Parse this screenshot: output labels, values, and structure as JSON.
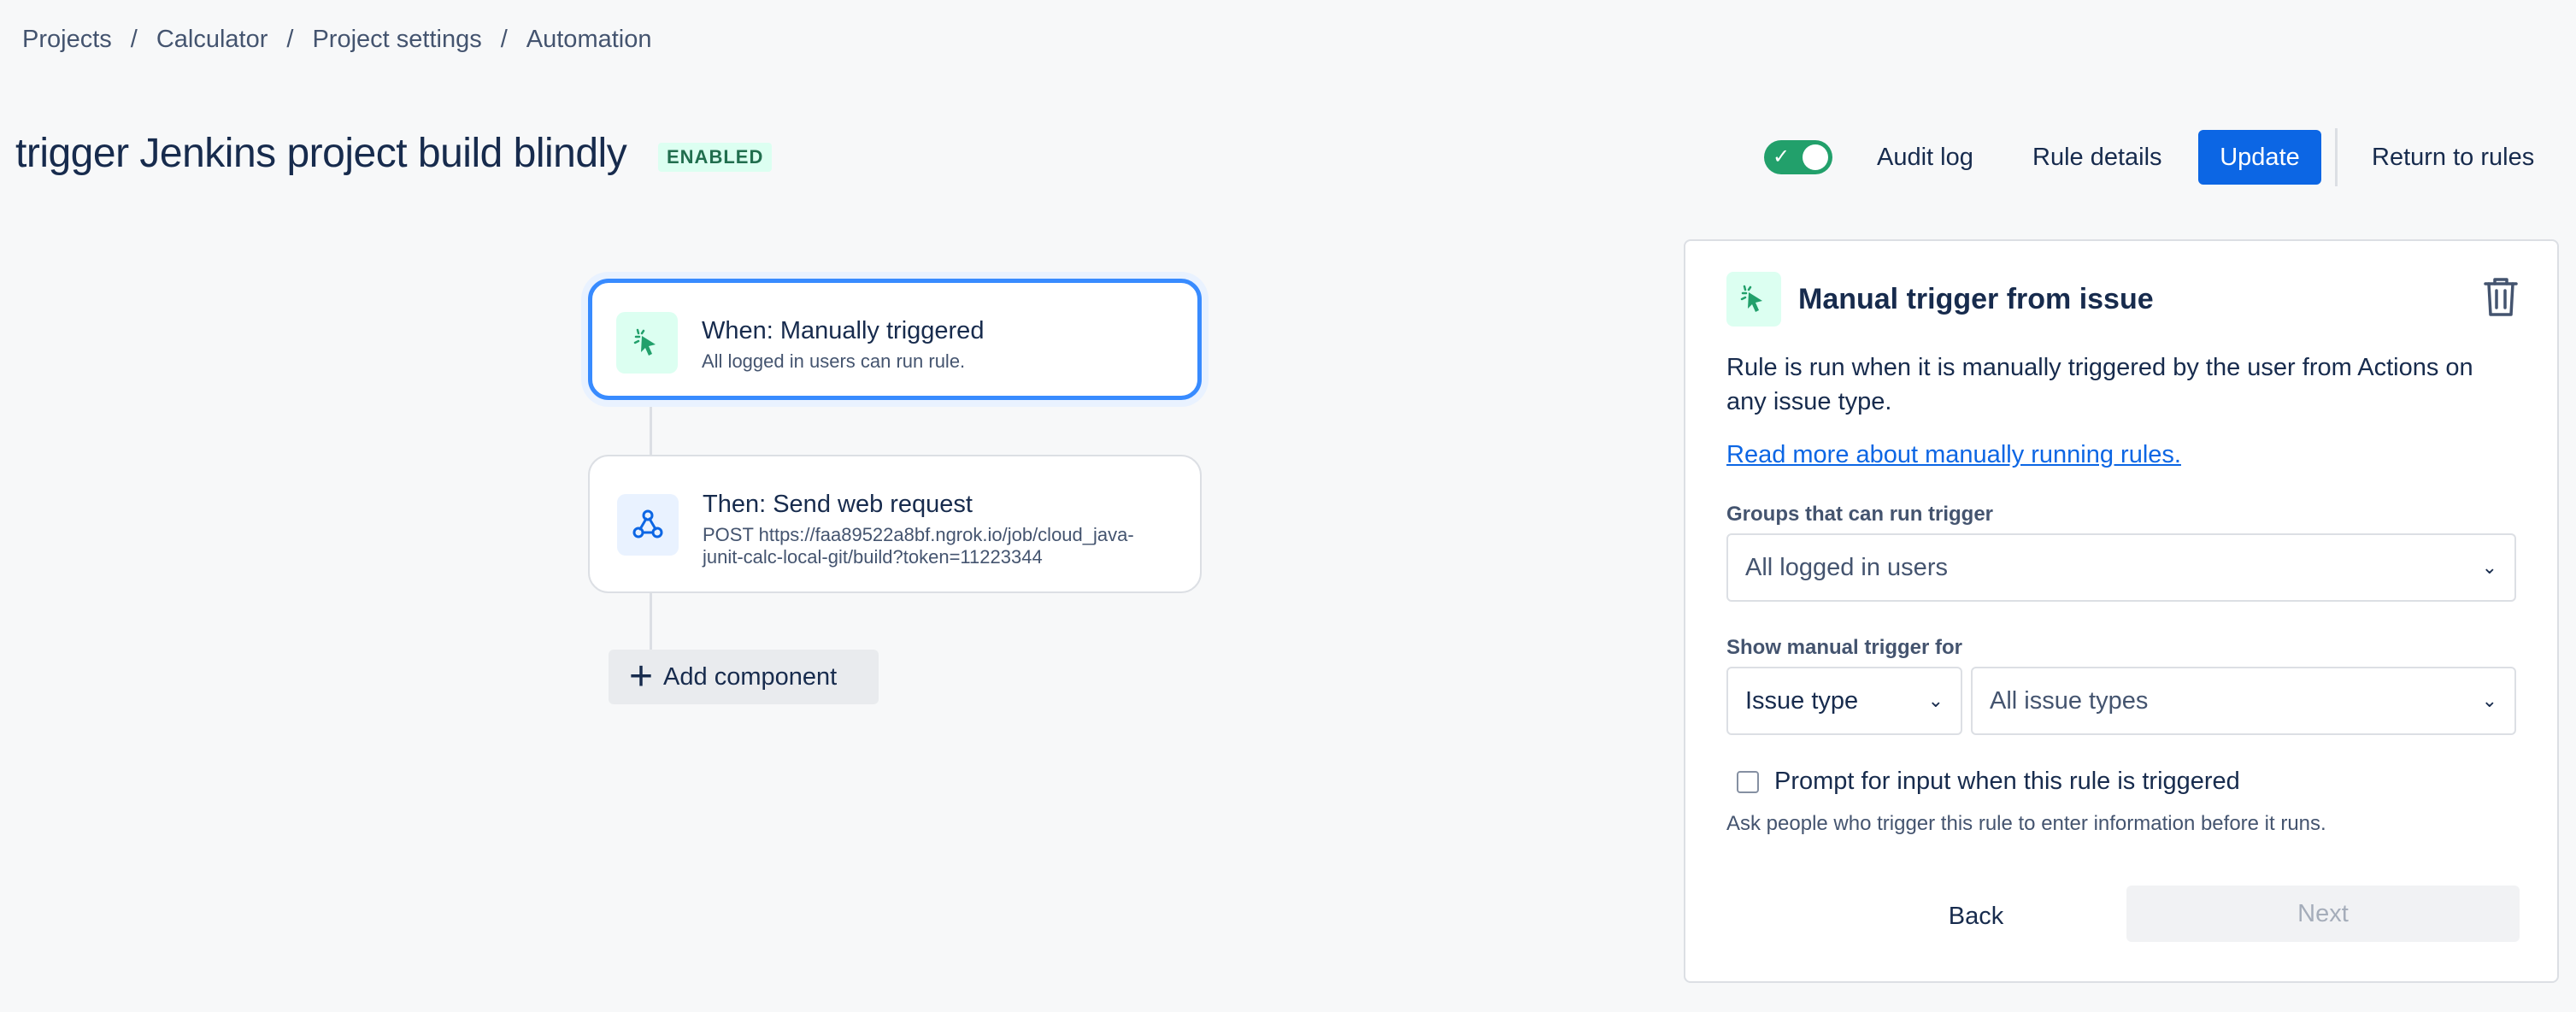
{
  "breadcrumb": [
    "Projects",
    "Calculator",
    "Project settings",
    "Automation"
  ],
  "breadcrumb_separator": "/",
  "header": {
    "title": "trigger Jenkins project build blindly",
    "status": "ENABLED",
    "toggle_on": true,
    "audit_log": "Audit log",
    "rule_details": "Rule details",
    "update": "Update",
    "return_to_rules": "Return to rules"
  },
  "flow": {
    "trigger": {
      "title": "When: Manually triggered",
      "subtitle": "All logged in users can run rule.",
      "icon": "cursor-click-icon"
    },
    "action": {
      "title": "Then: Send web request",
      "subtitle_line1": "POST https://faa89522a8bf.ngrok.io/job/cloud_java-",
      "subtitle_line2": "junit-calc-local-git/build?token=11223344",
      "icon": "webhook-icon"
    },
    "add_component": "Add component"
  },
  "panel": {
    "title": "Manual trigger from issue",
    "description": "Rule is run when it is manually triggered by the user from Actions on any issue type.",
    "link": "Read more about manually running rules.",
    "groups_label": "Groups that can run trigger",
    "groups_value": "All logged in users",
    "show_for_label": "Show manual trigger for",
    "show_for_type": "Issue type",
    "show_for_value": "All issue types",
    "prompt_label": "Prompt for input when this rule is triggered",
    "prompt_checked": false,
    "prompt_helper": "Ask people who trigger this rule to enter information before it runs.",
    "back": "Back",
    "next": "Next"
  },
  "colors": {
    "primary": "#0c66e4",
    "success": "#22a06b",
    "selected_border": "#388bff"
  }
}
